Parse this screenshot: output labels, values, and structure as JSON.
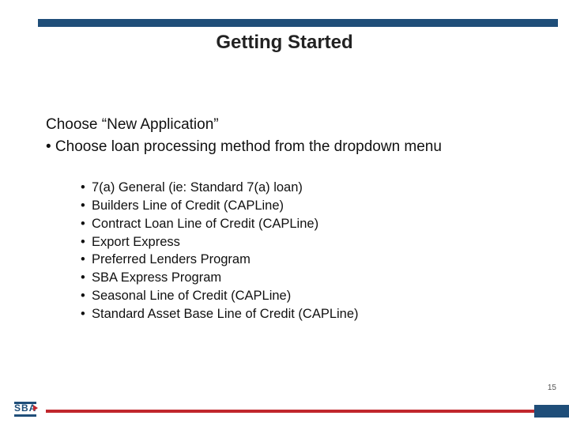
{
  "slide": {
    "title": "Getting Started",
    "intro_line1": "Choose “New Application”",
    "intro_line2": "• Choose loan processing method from the dropdown menu",
    "options": [
      "7(a) General (ie: Standard 7(a) loan)",
      "Builders Line of Credit (CAPLine)",
      "Contract Loan Line of Credit (CAPLine)",
      "Export Express",
      "Preferred Lenders Program",
      "SBA Express Program",
      "Seasonal Line of Credit (CAPLine)",
      "Standard Asset Base Line of Credit (CAPLine)"
    ],
    "page_number": "15",
    "logo_text": "SBA"
  }
}
